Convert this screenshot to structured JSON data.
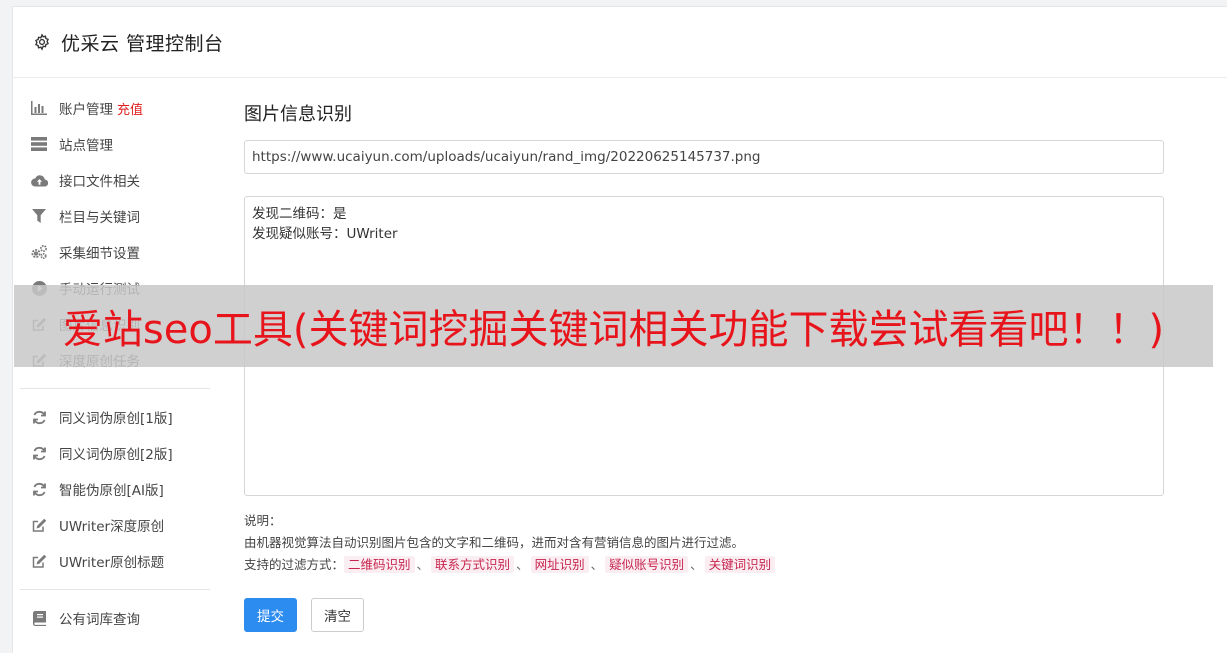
{
  "header": {
    "title": "优采云 管理控制台"
  },
  "sidebar": {
    "group1": [
      {
        "icon": "bar-chart-icon",
        "label": "账户管理",
        "badge": "充值"
      },
      {
        "icon": "server-icon",
        "label": "站点管理"
      },
      {
        "icon": "cloud-upload-icon",
        "label": "接口文件相关"
      },
      {
        "icon": "filter-icon",
        "label": "栏目与关键词"
      },
      {
        "icon": "cogs-icon",
        "label": "采集细节设置"
      },
      {
        "icon": "play-circle-icon",
        "label": "手动运行测试"
      },
      {
        "icon": "edit-icon",
        "label": "图片信息识别"
      },
      {
        "icon": "edit-icon",
        "label": "深度原创任务"
      }
    ],
    "group2": [
      {
        "icon": "refresh-icon",
        "label": "同义词伪原创[1版]"
      },
      {
        "icon": "refresh-icon",
        "label": "同义词伪原创[2版]"
      },
      {
        "icon": "refresh-icon",
        "label": "智能伪原创[AI版]"
      },
      {
        "icon": "edit-icon",
        "label": "UWriter深度原创"
      },
      {
        "icon": "edit-icon",
        "label": "UWriter原创标题"
      }
    ],
    "group3": [
      {
        "icon": "book-icon",
        "label": "公有词库查询"
      }
    ]
  },
  "main": {
    "title": "图片信息识别",
    "url_value": "https://www.ucaiyun.com/uploads/ucaiyun/rand_img/20220625145737.png",
    "result_lines": [
      "发现二维码：是",
      "发现疑似账号：UWriter"
    ],
    "desc_label": "说明：",
    "desc_text": "由机器视觉算法自动识别图片包含的文字和二维码，进而对含有营销信息的图片进行过滤。",
    "filter_label": "支持的过滤方式：",
    "filters": [
      "二维码识别",
      "联系方式识别",
      "网址识别",
      "疑似账号识别",
      "关键词识别"
    ],
    "separator": "、",
    "submit_label": "提交",
    "clear_label": "清空"
  },
  "overlay": {
    "text": "爱站seo工具(关键词挖掘关键词相关功能下载尝试看看吧！！)"
  },
  "colors": {
    "primary": "#2d8cf0",
    "badge": "#e02020",
    "tag_text": "#c7254e",
    "tag_bg": "#fbeef2",
    "overlay_text": "#e8141b"
  }
}
